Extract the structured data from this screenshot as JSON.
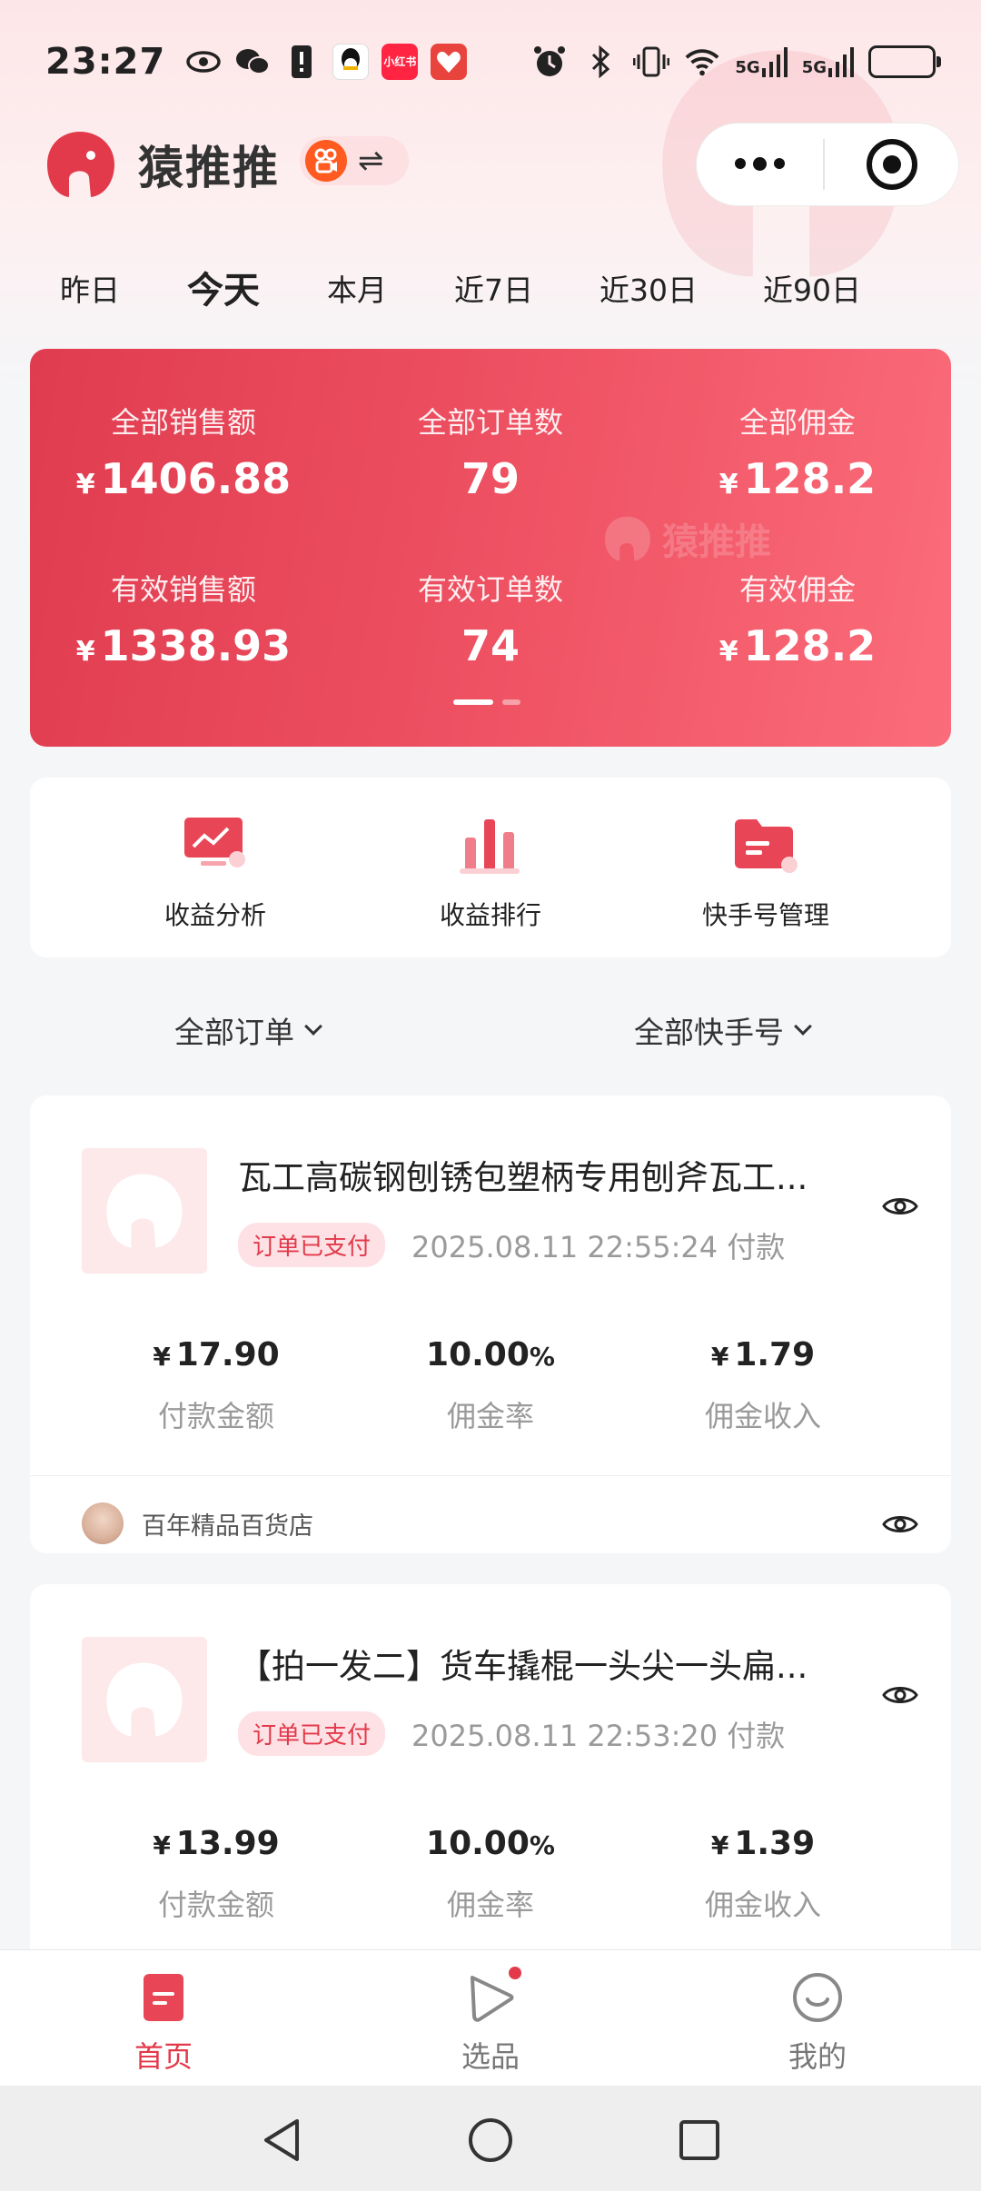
{
  "status_bar": {
    "time": "23:27",
    "left_icons": [
      "eye-icon",
      "wechat-icon",
      "alert-icon",
      "qq-icon",
      "xiaohongshu-icon",
      "app-icon"
    ],
    "xiaohongshu_label": "小红书",
    "right_icons": [
      "alarm-icon",
      "bluetooth-icon",
      "vibrate-icon",
      "wifi-icon",
      "signal-5g-icon",
      "signal-5g-icon",
      "battery-icon"
    ],
    "network_label": "5G",
    "battery_level": 0.12
  },
  "app": {
    "title": "猿推推",
    "brand_color": "#e23a4b",
    "watermark": "猿推推"
  },
  "date_tabs": [
    {
      "label": "昨日",
      "active": false
    },
    {
      "label": "今天",
      "active": true
    },
    {
      "label": "本月",
      "active": false
    },
    {
      "label": "近7日",
      "active": false
    },
    {
      "label": "近30日",
      "active": false
    },
    {
      "label": "近90日",
      "active": false
    }
  ],
  "stats": {
    "currency": "¥",
    "items": [
      {
        "label": "全部销售额",
        "value": "1406.88",
        "currency": true
      },
      {
        "label": "全部订单数",
        "value": "79",
        "currency": false
      },
      {
        "label": "全部佣金",
        "value": "128.2",
        "currency": true
      },
      {
        "label": "有效销售额",
        "value": "1338.93",
        "currency": true
      },
      {
        "label": "有效订单数",
        "value": "74",
        "currency": false
      },
      {
        "label": "有效佣金",
        "value": "128.2",
        "currency": true
      }
    ],
    "page_indicator": {
      "current": 1,
      "total": 2
    }
  },
  "quick_actions": [
    {
      "label": "收益分析",
      "icon": "chart-monitor-icon"
    },
    {
      "label": "收益排行",
      "icon": "bar-ranking-icon"
    },
    {
      "label": "快手号管理",
      "icon": "folder-manage-icon"
    }
  ],
  "filters": {
    "orders": "全部订单",
    "accounts": "全部快手号"
  },
  "orders": [
    {
      "title": "瓦工高碳钢刨锈包塑柄专用刨斧瓦工...",
      "status": "订单已支付",
      "time": "2025.08.11 22:55:24",
      "time_suffix": "付款",
      "pay_amount": "17.90",
      "pay_label": "付款金额",
      "rate": "10.00",
      "rate_unit": "%",
      "rate_label": "佣金率",
      "commission": "1.79",
      "commission_label": "佣金收入",
      "shop": "百年精品百货店"
    },
    {
      "title": "【拍一发二】货车撬棍一头尖一头扁...",
      "status": "订单已支付",
      "time": "2025.08.11 22:53:20",
      "time_suffix": "付款",
      "pay_amount": "13.99",
      "pay_label": "付款金额",
      "rate": "10.00",
      "rate_unit": "%",
      "rate_label": "佣金率",
      "commission": "1.39",
      "commission_label": "佣金收入"
    }
  ],
  "bottom_nav": [
    {
      "label": "首页",
      "icon": "home-doc-icon",
      "active": true
    },
    {
      "label": "选品",
      "icon": "play-select-icon",
      "active": false,
      "dot": true
    },
    {
      "label": "我的",
      "icon": "smile-profile-icon",
      "active": false
    }
  ],
  "system_nav": [
    "back-icon",
    "home-icon",
    "recents-icon"
  ]
}
